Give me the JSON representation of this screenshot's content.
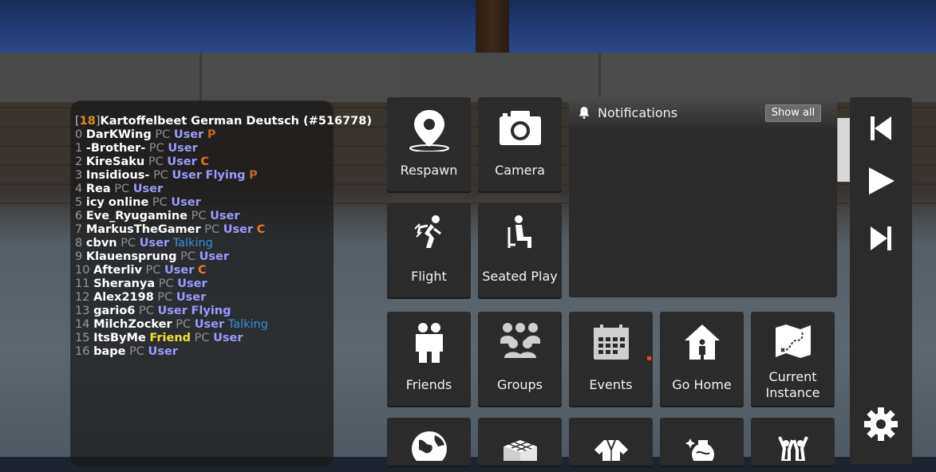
{
  "player_list": {
    "title_bracket_open": "[",
    "title_count": "18",
    "title_bracket_close": "]",
    "title_text": "Kartoffelbeet German Deutsch (#516778)",
    "rows": [
      {
        "idx": "0",
        "name": "DarKWing",
        "platform": "PC",
        "rank": "User",
        "tags": [
          "P"
        ]
      },
      {
        "idx": "1",
        "name": "-Brother-",
        "platform": "PC",
        "rank": "User",
        "tags": []
      },
      {
        "idx": "2",
        "name": "KireSaku",
        "platform": "PC",
        "rank": "User",
        "tags": [
          "C"
        ]
      },
      {
        "idx": "3",
        "name": "Insidious-",
        "platform": "PC",
        "rank": "User",
        "tags": [
          "Flying",
          "P"
        ]
      },
      {
        "idx": "4",
        "name": "Rea",
        "platform": "PC",
        "rank": "User",
        "tags": []
      },
      {
        "idx": "5",
        "name": "icy online",
        "platform": "PC",
        "rank": "User",
        "tags": []
      },
      {
        "idx": "6",
        "name": "Eve_Ryugamine",
        "platform": "PC",
        "rank": "User",
        "tags": []
      },
      {
        "idx": "7",
        "name": "MarkusTheGamer",
        "platform": "PC",
        "rank": "User",
        "tags": [
          "C"
        ]
      },
      {
        "idx": "8",
        "name": "cbvn",
        "platform": "PC",
        "rank": "User",
        "tags": [
          "Talking"
        ]
      },
      {
        "idx": "9",
        "name": "Klauensprung",
        "platform": "PC",
        "rank": "User",
        "tags": []
      },
      {
        "idx": "10",
        "name": "Afterliv",
        "platform": "PC",
        "rank": "User",
        "tags": [
          "C"
        ]
      },
      {
        "idx": "11",
        "name": "Sheranya",
        "platform": "PC",
        "rank": "User",
        "tags": []
      },
      {
        "idx": "12",
        "name": "Alex2198",
        "platform": "PC",
        "rank": "User",
        "tags": []
      },
      {
        "idx": "13",
        "name": "gario6",
        "platform": "PC",
        "rank": "User",
        "tags": [
          "Flying"
        ]
      },
      {
        "idx": "14",
        "name": "MilchZocker",
        "platform": "PC",
        "rank": "User",
        "tags": [
          "Talking"
        ]
      },
      {
        "idx": "15",
        "name": "ItsByMe",
        "platform": "PC",
        "rank": "User",
        "tags": [],
        "friend": "Friend"
      },
      {
        "idx": "16",
        "name": "bape",
        "platform": "PC",
        "rank": "User",
        "tags": []
      }
    ]
  },
  "menu": {
    "respawn": "Respawn",
    "camera": "Camera",
    "flight": "Flight",
    "seated_play": "Seated Play",
    "friends": "Friends",
    "groups": "Groups",
    "events": "Events",
    "go_home": "Go Home",
    "current_instance_line1": "Current",
    "current_instance_line2": "Instance"
  },
  "notifications": {
    "title": "Notifications",
    "show_all": "Show all"
  },
  "colors": {
    "tile_bg": "#2b2b2b",
    "rank_user": "#9b9bff",
    "tag_c": "#e67c17",
    "tag_talking": "#3a8fd8",
    "friend": "#f0e030",
    "event_dot": "#e8431c"
  },
  "icons": {
    "respawn": "map-pin-icon",
    "camera": "camera-icon",
    "flight": "running-figure-icon",
    "seated_play": "seated-figure-icon",
    "friends": "two-people-icon",
    "groups": "group-people-icon",
    "events": "calendar-icon",
    "go_home": "house-icon",
    "current_instance": "treasure-map-icon",
    "media_prev": "skip-back-icon",
    "media_play": "play-icon",
    "media_next": "skip-forward-icon",
    "settings": "gear-icon"
  }
}
